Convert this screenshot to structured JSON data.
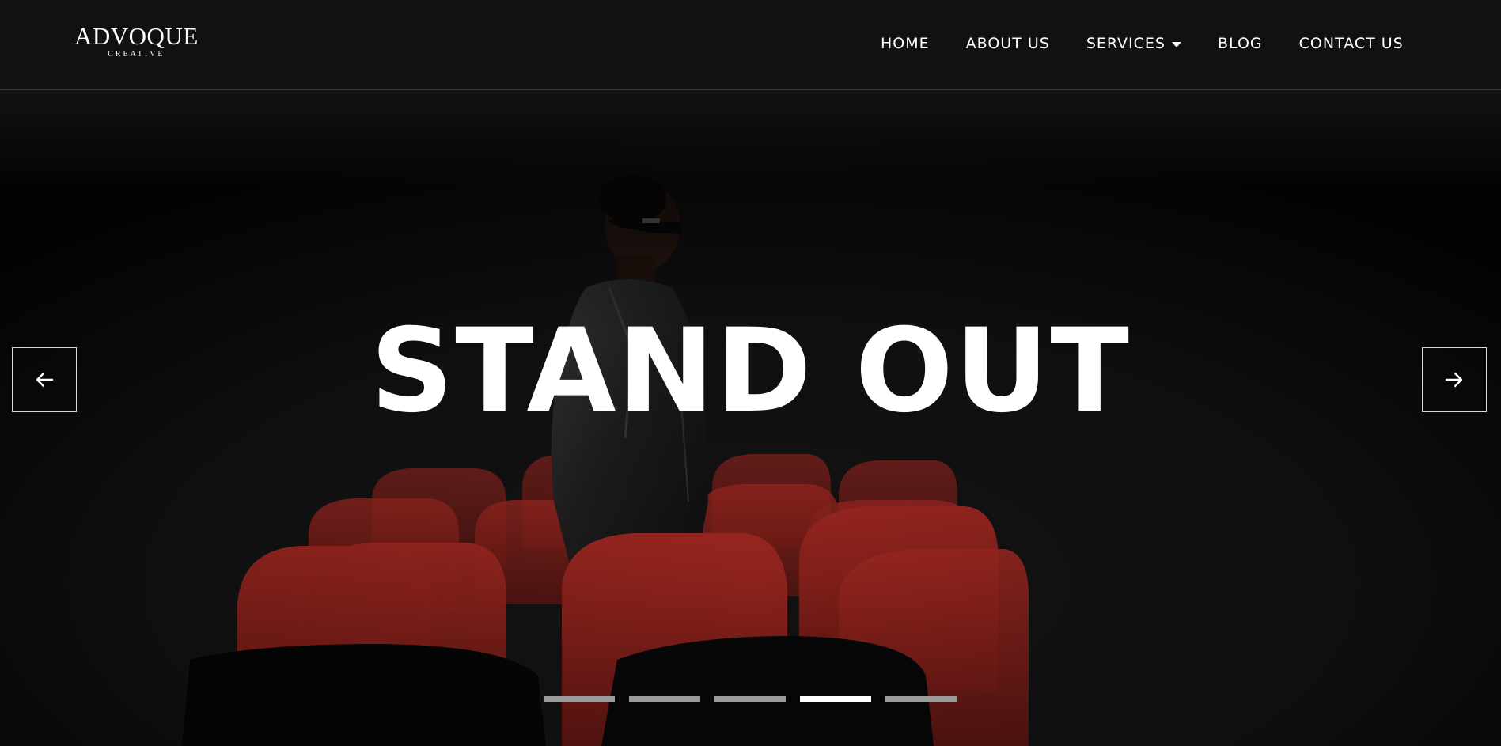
{
  "logo": {
    "main": "ADVOQUE",
    "sub": "CREATIVE"
  },
  "nav": {
    "items": [
      {
        "label": "HOME"
      },
      {
        "label": "ABOUT US"
      },
      {
        "label": "SERVICES",
        "icon": "caret-down-icon"
      },
      {
        "label": "BLOG"
      },
      {
        "label": "CONTACT US"
      }
    ]
  },
  "hero": {
    "title": "STAND OUT",
    "prev_icon": "arrow-left-icon",
    "next_icon": "arrow-right-icon",
    "slides_count": 5,
    "active_slide": 4
  },
  "colors": {
    "background": "#111111",
    "text": "#ffffff",
    "seat_red": "#8e1f1a",
    "indicator_inactive": "#9a9a9a",
    "indicator_active": "#ffffff"
  }
}
